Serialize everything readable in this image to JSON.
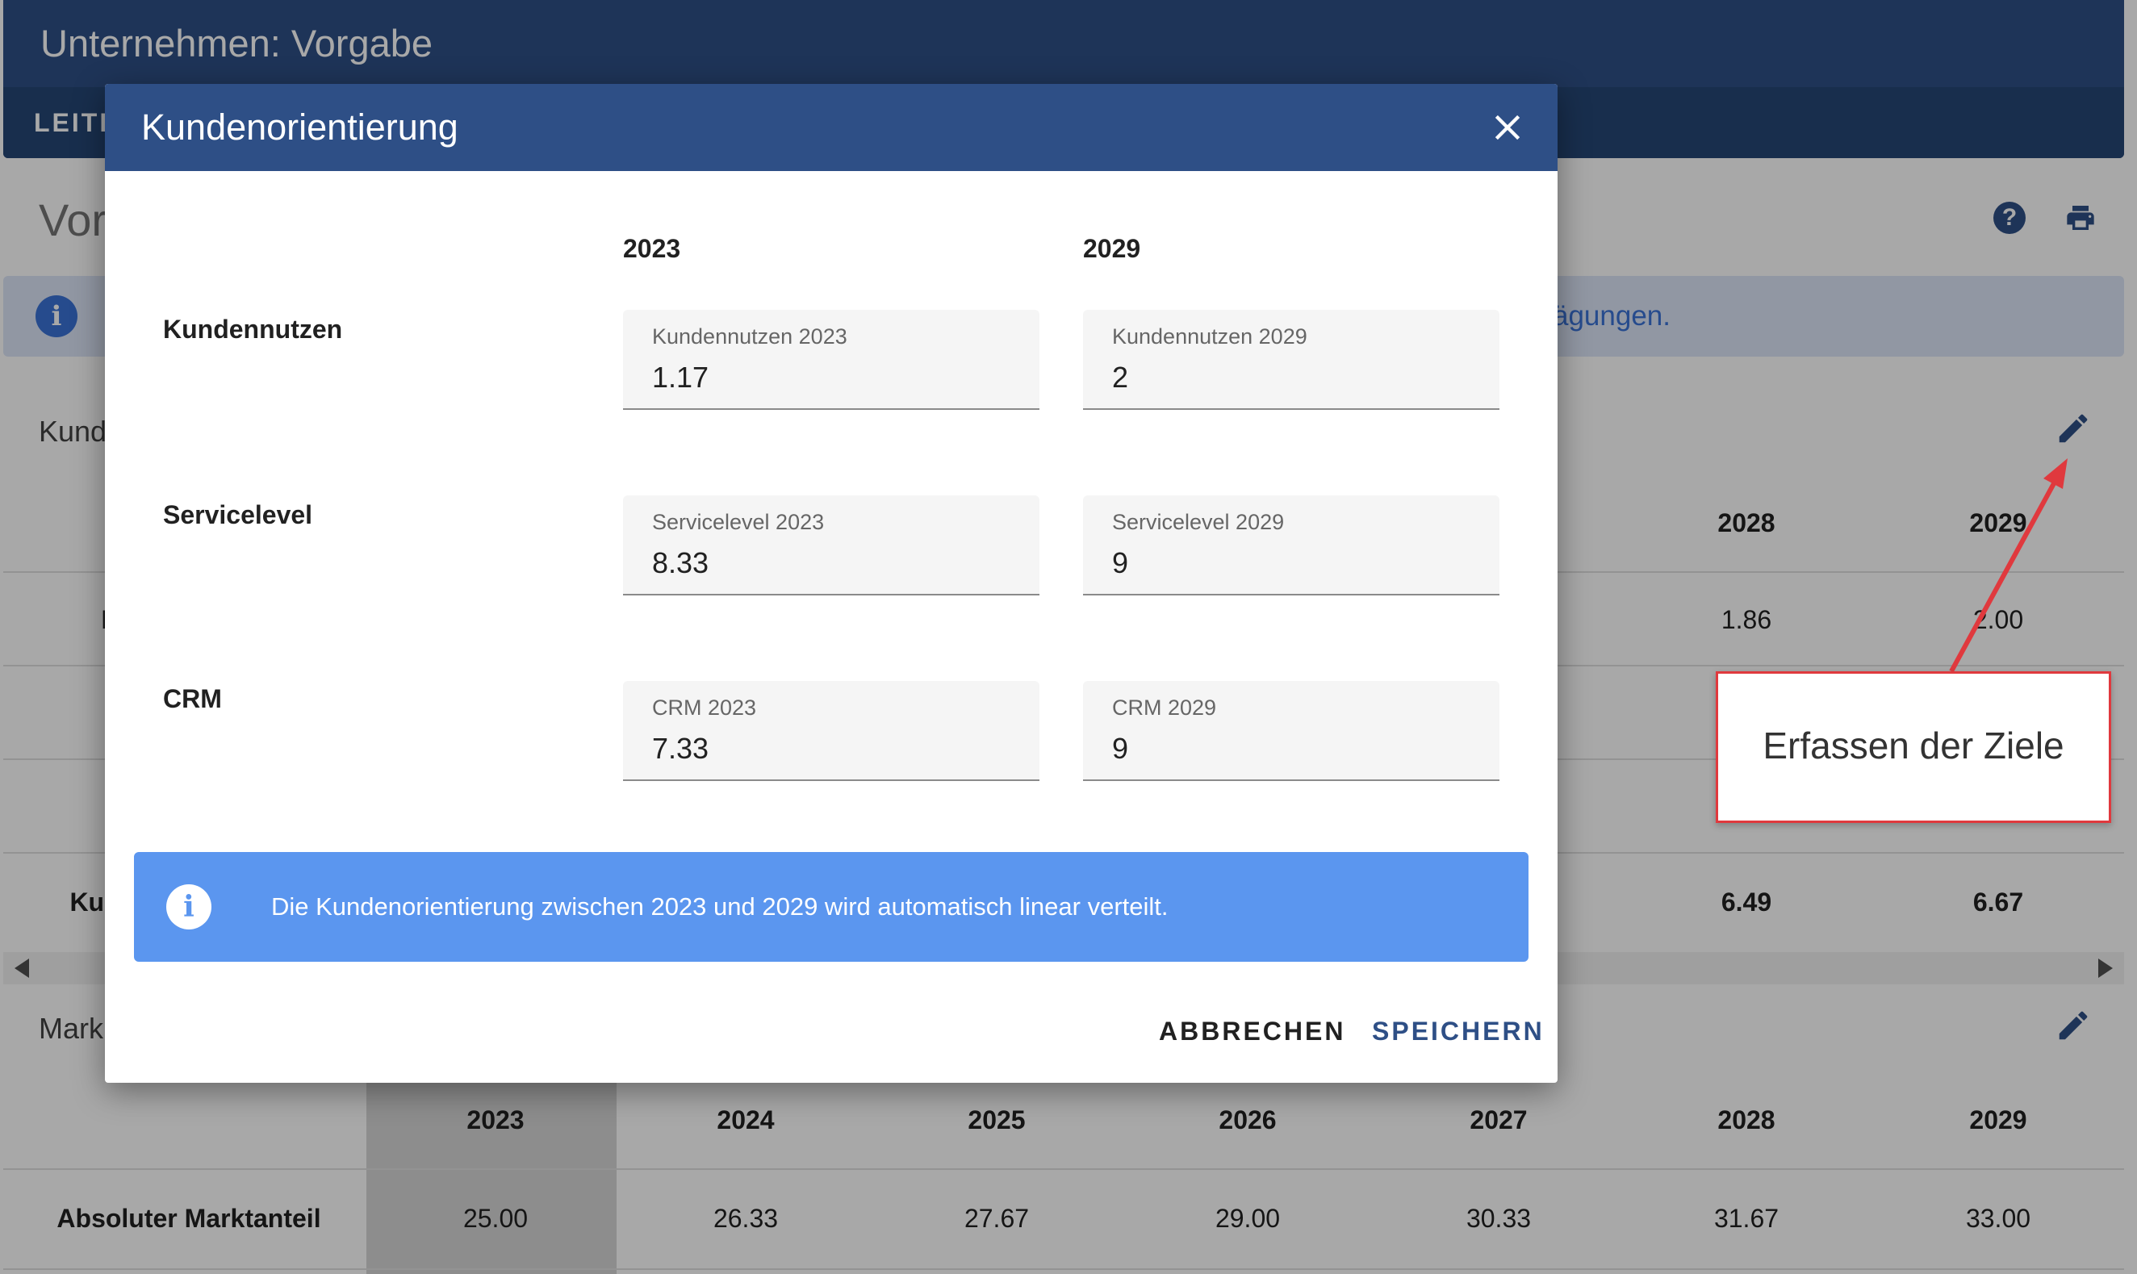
{
  "app": {
    "title": "Unternehmen: Vorgabe",
    "tab_label": "LEITE"
  },
  "page": {
    "heading": "Vor",
    "info_text": "ägungen.",
    "section1_title": "Kund",
    "section2_title": "Mark"
  },
  "bg_table1": {
    "header_years": [
      "2028",
      "2029"
    ],
    "row1_values": [
      "1.86",
      "2.00"
    ],
    "row1_label": "I",
    "total_label": "Kur",
    "total_values": [
      "6.49",
      "6.67"
    ]
  },
  "bg_table2": {
    "years": [
      "2023",
      "2024",
      "2025",
      "2026",
      "2027",
      "2028",
      "2029"
    ],
    "row_label": "Absoluter Marktanteil",
    "row_values": [
      "25.00",
      "26.33",
      "27.67",
      "29.00",
      "30.33",
      "31.67",
      "33.00"
    ]
  },
  "annotation": {
    "text": "Erfassen der Ziele",
    "color": "#e0393e"
  },
  "dialog": {
    "title": "Kundenorientierung",
    "col_headers": [
      "2023",
      "2029"
    ],
    "rows": [
      {
        "label": "Kundennutzen",
        "field_2023": {
          "label": "Kundennutzen 2023",
          "value": "1.17"
        },
        "field_2029": {
          "label": "Kundennutzen 2029",
          "value": "2"
        }
      },
      {
        "label": "Servicelevel",
        "field_2023": {
          "label": "Servicelevel 2023",
          "value": "8.33"
        },
        "field_2029": {
          "label": "Servicelevel 2029",
          "value": "9"
        }
      },
      {
        "label": "CRM",
        "field_2023": {
          "label": "CRM 2023",
          "value": "7.33"
        },
        "field_2029": {
          "label": "CRM 2029",
          "value": "9"
        }
      }
    ],
    "info_text": "Die Kundenorientierung zwischen 2023 und 2029 wird automatisch linear verteilt.",
    "cancel_label": "ABBRECHEN",
    "save_label": "SPEICHERN"
  },
  "colors": {
    "primary": "#2e4f86",
    "info_bg": "#5b96ef",
    "accent_red": "#e0393e"
  },
  "icons": {
    "help": "help-circle-icon",
    "print": "printer-icon",
    "edit": "pencil-icon",
    "close": "close-icon",
    "info": "info-circle-icon"
  }
}
